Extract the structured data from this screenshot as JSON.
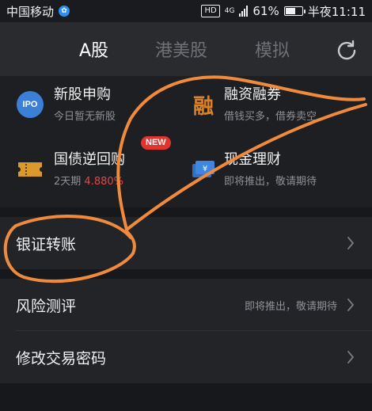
{
  "status": {
    "carrier": "中国移动",
    "hd": "HD",
    "network": "4G",
    "battery_percent": "61%",
    "battery_level": 0.61,
    "time": "半夜11:11"
  },
  "tabs": [
    {
      "label": "A股",
      "active": true
    },
    {
      "label": "港美股",
      "active": false
    },
    {
      "label": "模拟",
      "active": false
    }
  ],
  "grid": {
    "ipo": {
      "icon_text": "IPO",
      "title": "新股申购",
      "subtitle": "今日暂无新股"
    },
    "margin": {
      "icon_text": "融",
      "title": "融资融券",
      "subtitle": "借钱买多，借券卖空"
    },
    "repo": {
      "title": "国债逆回购",
      "badge": "NEW",
      "term": "2天期",
      "rate": "4.880%"
    },
    "cash": {
      "title": "现金理财",
      "subtitle": "即将推出，敬请期待"
    }
  },
  "menu": [
    {
      "label": "银证转账",
      "hint": ""
    },
    {
      "label": "风险测评",
      "hint": "即将推出，敬请期待"
    },
    {
      "label": "修改交易密码",
      "hint": ""
    }
  ],
  "colors": {
    "background": "#1e1f22",
    "header": "#2a2b2f",
    "annotation": "#f08a3c",
    "rate_red": "#e64545",
    "new_badge": "#e0342f"
  }
}
